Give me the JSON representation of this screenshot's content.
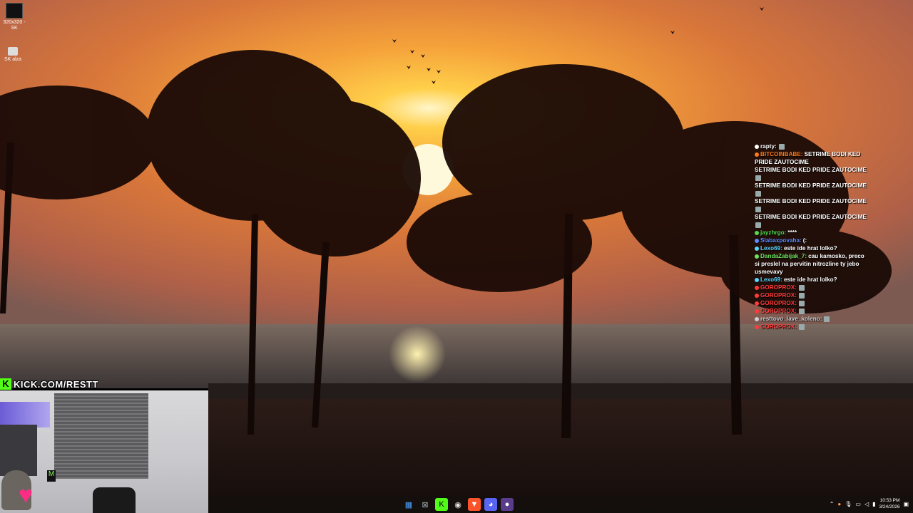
{
  "desktop": {
    "icons": [
      {
        "label": "320x320 - SK",
        "icon": "image-file-icon"
      },
      {
        "label": "SK alza",
        "icon": "shortcut-icon"
      }
    ]
  },
  "stream_overlay": {
    "brand_letter": "K",
    "url": "KICK.COM/RESTT",
    "accent": "#53fc18"
  },
  "chat": {
    "messages": [
      {
        "user": "rapty:",
        "text": "",
        "color": "#ffffff"
      },
      {
        "user": "BITCOINBABE:",
        "text": "SETRIME BODI KED PRIDE ZAUTOCIME",
        "color": "#ff7a1a"
      },
      {
        "user": "",
        "text": "SETRIME BODI KED PRIDE ZAUTOCIME",
        "color": "#ffffff"
      },
      {
        "user": "",
        "text": "SETRIME BODI KED PRIDE ZAUTOCIME",
        "color": "#ffffff"
      },
      {
        "user": "",
        "text": "SETRIME BODI KED PRIDE ZAUTOCIME",
        "color": "#ffffff"
      },
      {
        "user": "",
        "text": "SETRIME BODI KED PRIDE ZAUTOCIME",
        "color": "#ffffff"
      },
      {
        "user": "jayzhrgo:",
        "text": "****",
        "color": "#4fdc4f"
      },
      {
        "user": "Slabaxpovaha:",
        "text": "(:",
        "color": "#5a8cff"
      },
      {
        "user": "Lexo69:",
        "text": "este ide hrat lolko?",
        "color": "#58d6ff"
      },
      {
        "user": "DandaZabijak_7:",
        "text": "cau kamosko, preco si preslel na pervitin nitrozline ty jebo usmevavy",
        "color": "#6ee35e"
      },
      {
        "user": "Lexo69:",
        "text": "este ide hrat lolko?",
        "color": "#58d6ff"
      },
      {
        "user": "GOROPROX:",
        "text": "",
        "color": "#ff3b3b"
      },
      {
        "user": "GOROPROX:",
        "text": "",
        "color": "#ff3b3b"
      },
      {
        "user": "GOROPROX:",
        "text": "",
        "color": "#ff3b3b"
      },
      {
        "user": "GOROPROX:",
        "text": "",
        "color": "#ff3b3b"
      },
      {
        "user": "resttovo_lave_koleno:",
        "text": "",
        "color": "#cfcfcf"
      },
      {
        "user": "GOROPROX:",
        "text": "",
        "color": "#ff3b3b"
      }
    ]
  },
  "taskbar": {
    "apps": [
      {
        "icon": "windows-start-icon",
        "glyph": "▦",
        "bg": "transparent",
        "fg": "#4aa3ff"
      },
      {
        "icon": "xbox-icon",
        "glyph": "⊠",
        "bg": "transparent",
        "fg": "#9aa"
      },
      {
        "icon": "kick-app-icon",
        "glyph": "K",
        "bg": "#53fc18",
        "fg": "#000"
      },
      {
        "icon": "chrome-icon",
        "glyph": "◉",
        "bg": "transparent",
        "fg": "#e5e5e5"
      },
      {
        "icon": "brave-icon",
        "glyph": "▼",
        "bg": "#fb542b",
        "fg": "#fff"
      },
      {
        "icon": "discord-icon",
        "glyph": "◕",
        "bg": "#5865f2",
        "fg": "#fff"
      },
      {
        "icon": "obs-icon",
        "glyph": "●",
        "bg": "#5a3d8a",
        "fg": "#fff"
      }
    ],
    "time": "10:53 PM",
    "date": "3/24/2026"
  }
}
